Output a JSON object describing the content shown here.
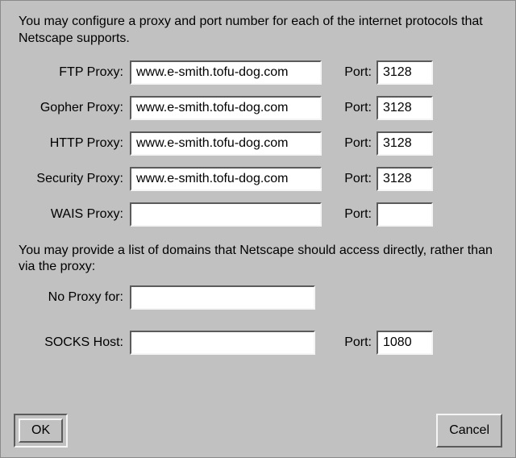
{
  "intro": "You may configure a proxy and port number for each of the internet protocols that Netscape supports.",
  "port_label": "Port:",
  "proxies": {
    "ftp": {
      "label": "FTP Proxy:",
      "host": "www.e-smith.tofu-dog.com",
      "port": "3128"
    },
    "gopher": {
      "label": "Gopher Proxy:",
      "host": "www.e-smith.tofu-dog.com",
      "port": "3128"
    },
    "http": {
      "label": "HTTP Proxy:",
      "host": "www.e-smith.tofu-dog.com",
      "port": "3128"
    },
    "security": {
      "label": "Security Proxy:",
      "host": "www.e-smith.tofu-dog.com",
      "port": "3128"
    },
    "wais": {
      "label": "WAIS Proxy:",
      "host": "",
      "port": ""
    }
  },
  "intro2": "You may provide a list of domains that Netscape should access directly, rather than via the proxy:",
  "noproxy": {
    "label": "No Proxy for:",
    "value": ""
  },
  "socks": {
    "label": "SOCKS Host:",
    "host": "",
    "port": "1080"
  },
  "buttons": {
    "ok": "OK",
    "cancel": "Cancel"
  }
}
